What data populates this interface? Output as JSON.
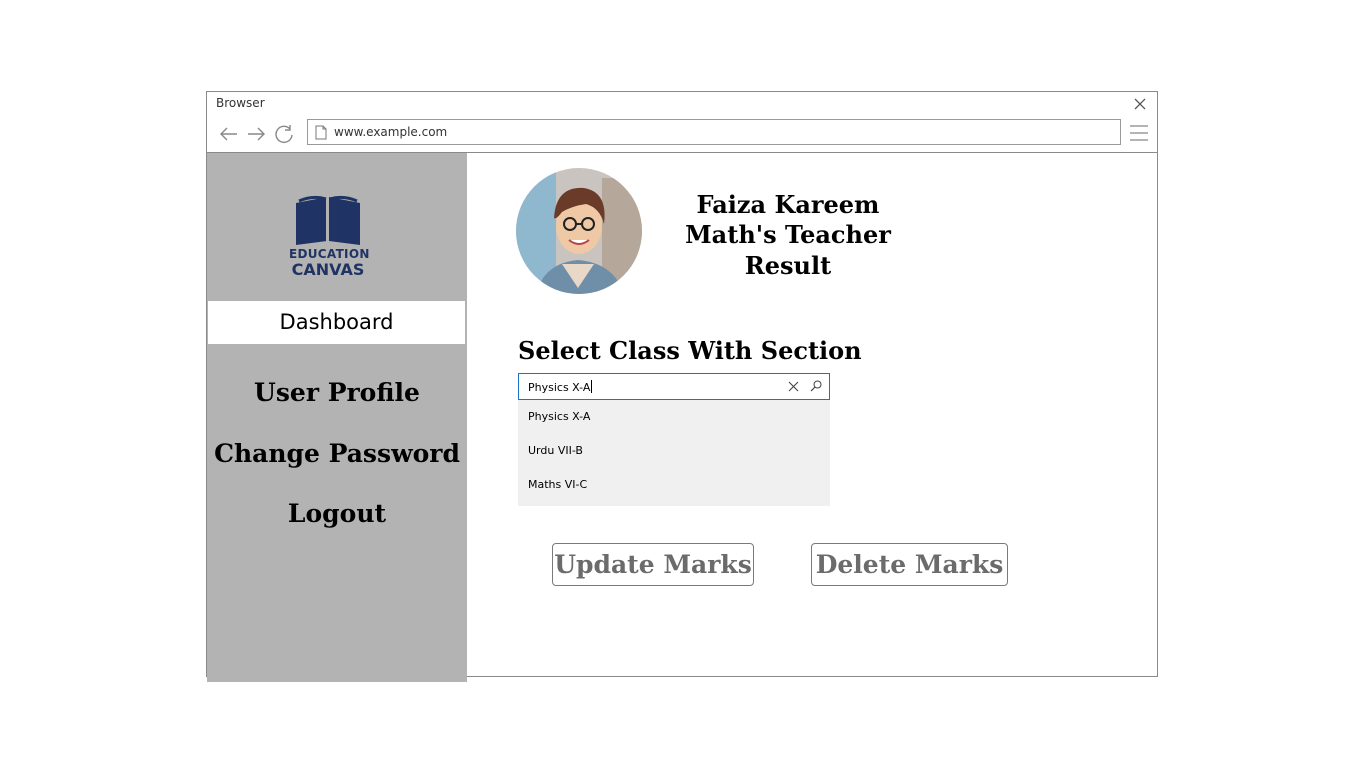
{
  "browser": {
    "title": "Browser",
    "url": "www.example.com"
  },
  "sidebar": {
    "logo": {
      "line1": "EDUCATION",
      "line2": "CANVAS",
      "color": "#1f3464"
    },
    "items": [
      {
        "label": "Dashboard",
        "active": true
      },
      {
        "label": "User Profile"
      },
      {
        "label": "Change Password"
      },
      {
        "label": "Logout"
      }
    ]
  },
  "profile": {
    "name": "Faiza Kareem",
    "role": "Math's Teacher",
    "page": "Result"
  },
  "class_select": {
    "title": "Select Class With Section",
    "value": "Physics X-A",
    "options": [
      "Physics X-A",
      "Urdu VII-B",
      "Maths VI-C"
    ]
  },
  "actions": {
    "update_label": "Update Marks",
    "delete_label": "Delete Marks"
  },
  "colors": {
    "sidebar_bg": "#b3b3b3",
    "dropdown_bg": "#f0f0f0",
    "focus_border": "#1a73c8"
  },
  "icons": [
    "close-icon",
    "back-arrow-icon",
    "forward-arrow-icon",
    "refresh-icon",
    "page-icon",
    "hamburger-menu-icon",
    "book-icon",
    "clear-icon",
    "search-icon"
  ]
}
